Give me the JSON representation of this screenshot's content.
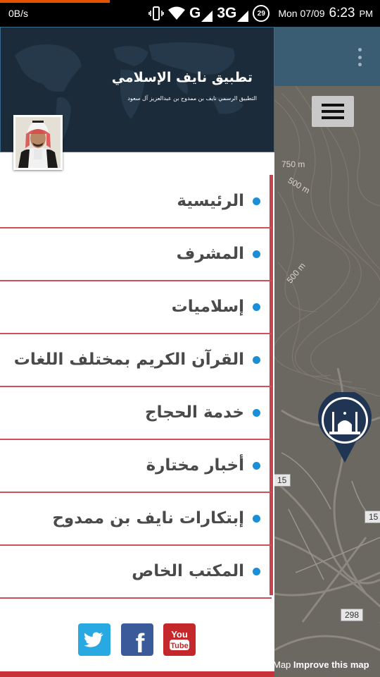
{
  "status_bar": {
    "net_speed": "0B/s",
    "network_g": "G",
    "network_3g": "3G",
    "battery": "29",
    "date": "Mon 07/09",
    "time": "6:23",
    "ampm": "PM",
    "progress_color": "#e65100"
  },
  "drawer": {
    "header": {
      "title": "تطبيق نايف الإسلامي",
      "subtitle": "التطبيق الرسمي نايف بن ممدوح بن عبدالعزيز آل سعود",
      "background_color": "#1c2b39"
    },
    "menu": [
      {
        "label": "الرئيسية"
      },
      {
        "label": "المشرف"
      },
      {
        "label": "إسلاميات"
      },
      {
        "label": "القرآن الكريم بمختلف اللغات"
      },
      {
        "label": "خدمة الحجاج"
      },
      {
        "label": "أخبار مختارة"
      },
      {
        "label": "إبتكارات نايف بن ممدوح"
      },
      {
        "label": "المكتب الخاص"
      }
    ],
    "accent_color": "#c9434e",
    "bullet_color": "#1a8fd8",
    "social": [
      {
        "icon": "twitter-icon",
        "color": "#29a9e1"
      },
      {
        "icon": "facebook-icon",
        "color": "#3a5a99",
        "text": "f"
      },
      {
        "icon": "youtube-icon",
        "color": "#c4282b",
        "text_top": "You",
        "text_bottom": "Tube"
      }
    ]
  },
  "map": {
    "toolbar_color": "#3a5d73",
    "contour_labels": [
      "750 m",
      "500 m",
      "500 m"
    ],
    "road_shields": [
      "15",
      "15",
      "298"
    ],
    "attribution_prefix": "Map",
    "attribution_link": "Improve this map",
    "marker_icon": "mosque-icon"
  }
}
